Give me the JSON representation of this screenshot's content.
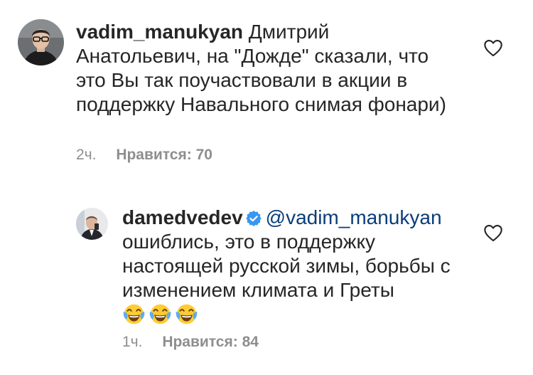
{
  "comments": [
    {
      "username": "vadim_manukyan",
      "text": "Дмитрий Анатольевич, на \"Дожде\" сказали, что это Вы так поучаствовали в акции в поддержку Навального снимая фонари)",
      "time": "2ч.",
      "likes": "Нравится: 70",
      "avatar_icon": "user-avatar-glasses",
      "like_icon": "heart-outline-icon"
    },
    {
      "username": "damedvedev",
      "verified": true,
      "mention": "@vadim_manukyan",
      "text": "ошиблись, это в поддержку настоящей русской зимы, борьбы с изменением климата и Греты",
      "emojis": [
        "face-with-tears-of-joy",
        "face-with-tears-of-joy",
        "face-with-tears-of-joy"
      ],
      "time": "1ч.",
      "likes": "Нравится: 84",
      "avatar_icon": "user-avatar-suit",
      "like_icon": "heart-outline-icon"
    }
  ],
  "colors": {
    "text": "#262626",
    "meta": "#8e8e8e",
    "mention": "#0a3d7a",
    "verified_badge": "#3897f0"
  }
}
